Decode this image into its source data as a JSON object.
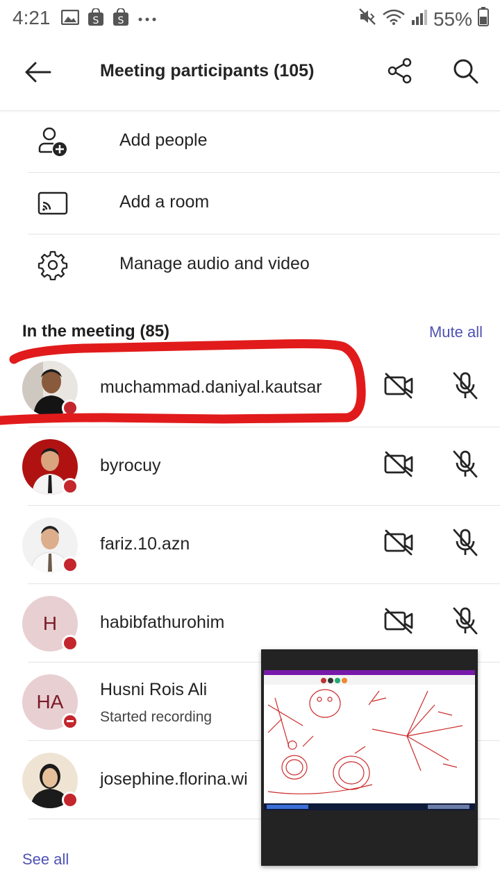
{
  "status_bar": {
    "time": "4:21",
    "battery": "55%",
    "left_icons": [
      "image-icon",
      "shopping-bag-icon",
      "shopping-bag-icon",
      "more-dots-icon"
    ],
    "right_icons": [
      "mute-icon",
      "wifi-icon",
      "signal-icon",
      "battery-icon"
    ]
  },
  "header": {
    "title": "Meeting participants (105)",
    "back_icon": "arrow-left-icon",
    "share_icon": "share-icon",
    "search_icon": "search-icon"
  },
  "actions": [
    {
      "label": "Add people",
      "icon": "add-person-icon"
    },
    {
      "label": "Add a room",
      "icon": "cast-icon"
    },
    {
      "label": "Manage audio and video",
      "icon": "gear-icon"
    }
  ],
  "section": {
    "title": "In the meeting (85)",
    "mute_all": "Mute all"
  },
  "participants": [
    {
      "name": "muchammad.daniyal.kautsar",
      "initials": "",
      "subtitle": "",
      "status": "busy"
    },
    {
      "name": "byrocuy",
      "initials": "",
      "subtitle": "",
      "status": "busy"
    },
    {
      "name": "fariz.10.azn",
      "initials": "",
      "subtitle": "",
      "status": "busy"
    },
    {
      "name": "habibfathurohim",
      "initials": "H",
      "subtitle": "",
      "status": "busy"
    },
    {
      "name": "Husni Rois Ali",
      "initials": "HA",
      "subtitle": "Started recording",
      "status": "do-not-disturb"
    },
    {
      "name": "josephine.florina.wi",
      "initials": "",
      "subtitle": "",
      "status": "busy"
    }
  ],
  "see_all": "See all",
  "colors": {
    "accent": "#4f52b2",
    "status_red": "#c4262e",
    "annotation_red": "#e11b1b",
    "initials_bg": "#e8cfd2"
  }
}
